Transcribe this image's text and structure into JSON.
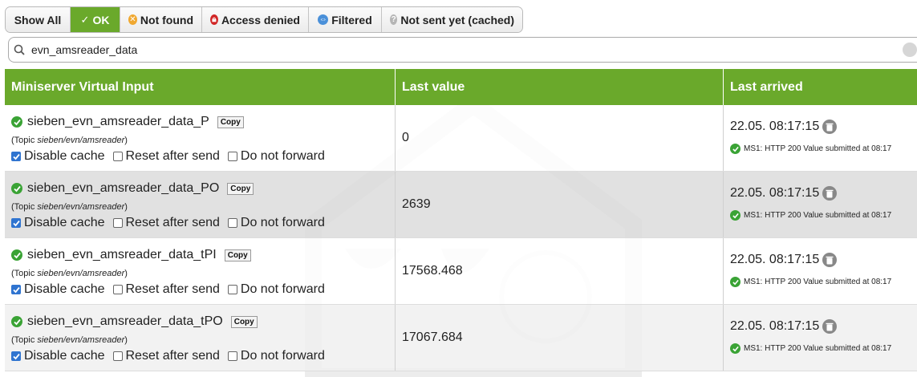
{
  "filters": [
    {
      "label": "Show All",
      "icon": "",
      "active": false
    },
    {
      "label": "OK",
      "icon": "check-icon",
      "active": true
    },
    {
      "label": "Not found",
      "icon": "not-found-icon",
      "active": false
    },
    {
      "label": "Access denied",
      "icon": "access-denied-icon",
      "active": false
    },
    {
      "label": "Filtered",
      "icon": "filtered-icon",
      "active": false
    },
    {
      "label": "Not sent yet (cached)",
      "icon": "cached-icon",
      "active": false
    }
  ],
  "search": {
    "value": "evn_amsreader_data"
  },
  "table": {
    "headers": [
      "Miniserver Virtual Input",
      "Last value",
      "Last arrived"
    ],
    "copy_label": "Copy",
    "topic_prefix": "(Topic ",
    "topic_suffix": ")",
    "disable_cache_label": "Disable cache",
    "reset_after_send_label": "Reset after send",
    "do_not_forward_label": "Do not forward",
    "rows": [
      {
        "name": "sieben_evn_amsreader_data_P",
        "topic": "sieben/evn/amsreader",
        "disable_cache": true,
        "reset_after_send": false,
        "do_not_forward": false,
        "value": "0",
        "arrived": "22.05. 08:17:15",
        "status": "MS1: HTTP 200 Value submitted at 08:17"
      },
      {
        "name": "sieben_evn_amsreader_data_PO",
        "topic": "sieben/evn/amsreader",
        "disable_cache": true,
        "reset_after_send": false,
        "do_not_forward": false,
        "value": "2639",
        "arrived": "22.05. 08:17:15",
        "status": "MS1: HTTP 200 Value submitted at 08:17"
      },
      {
        "name": "sieben_evn_amsreader_data_tPI",
        "topic": "sieben/evn/amsreader",
        "disable_cache": true,
        "reset_after_send": false,
        "do_not_forward": false,
        "value": "17568.468",
        "arrived": "22.05. 08:17:15",
        "status": "MS1: HTTP 200 Value submitted at 08:17"
      },
      {
        "name": "sieben_evn_amsreader_data_tPO",
        "topic": "sieben/evn/amsreader",
        "disable_cache": true,
        "reset_after_send": false,
        "do_not_forward": false,
        "value": "17067.684",
        "arrived": "22.05. 08:17:15",
        "status": "MS1: HTTP 200 Value submitted at 08:17"
      }
    ]
  },
  "colors": {
    "header_green": "#6aa92b",
    "ok_green": "#3aa335",
    "checkbox_blue": "#2f74d0"
  }
}
